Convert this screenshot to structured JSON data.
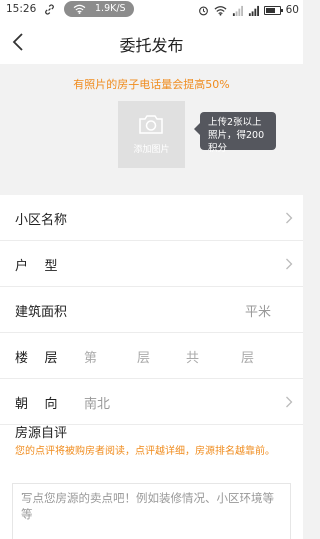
{
  "status_bar": {
    "time": "15:26",
    "net_speed": "1.9K/S",
    "battery": "60"
  },
  "nav": {
    "title": "委托发布"
  },
  "photo": {
    "tip": "有照片的房子电话量会提高50%",
    "add_label": "添加图片",
    "bubble": "上传2张以上照片，得200积分"
  },
  "form": {
    "community": {
      "label": "小区名称"
    },
    "layout": {
      "label": "户    型"
    },
    "area": {
      "label": "建筑面积",
      "unit": "平米"
    },
    "floor": {
      "label": "楼    层",
      "di": "第",
      "ceng1": "层",
      "gong": "共",
      "ceng2": "层"
    },
    "orientation": {
      "label": "朝    向",
      "value": "南北"
    }
  },
  "description": {
    "label": "房源自评",
    "hint": "您的点评将被购房者阅读，点评越详细，房源排名越靠前。",
    "placeholder": "写点您房源的卖点吧！例如装修情况、小区环境等等"
  }
}
